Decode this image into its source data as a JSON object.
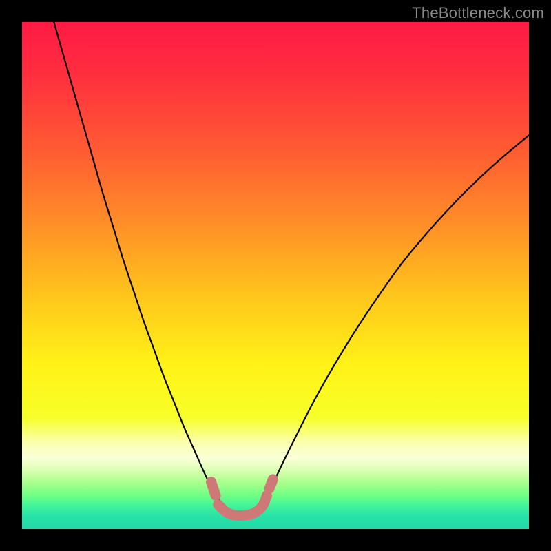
{
  "watermark": "TheBottleneck.com",
  "colors": {
    "curve": "#000000",
    "marker": "#cf7878",
    "background": "#000000",
    "gradient_stops": [
      {
        "offset": 0.0,
        "color": "#ff1a44"
      },
      {
        "offset": 0.1,
        "color": "#ff2e3f"
      },
      {
        "offset": 0.25,
        "color": "#ff5a33"
      },
      {
        "offset": 0.4,
        "color": "#ff8f27"
      },
      {
        "offset": 0.55,
        "color": "#ffc91c"
      },
      {
        "offset": 0.68,
        "color": "#fff317"
      },
      {
        "offset": 0.78,
        "color": "#f7ff28"
      },
      {
        "offset": 0.83,
        "color": "#faffb0"
      },
      {
        "offset": 0.86,
        "color": "#fbffd8"
      },
      {
        "offset": 0.885,
        "color": "#d8ffb0"
      },
      {
        "offset": 0.91,
        "color": "#a6ff8a"
      },
      {
        "offset": 0.935,
        "color": "#6dff85"
      },
      {
        "offset": 0.955,
        "color": "#40f29a"
      },
      {
        "offset": 0.975,
        "color": "#28e2a8"
      },
      {
        "offset": 1.0,
        "color": "#22d8a6"
      }
    ]
  },
  "chart_data": {
    "type": "line",
    "title": "",
    "xlabel": "",
    "ylabel": "",
    "xlim": [
      0,
      100
    ],
    "ylim": [
      0,
      100
    ],
    "series": [
      {
        "name": "curve-left",
        "x": [
          6,
          8,
          10,
          12,
          14,
          16,
          18,
          20,
          22,
          24,
          26,
          28,
          30,
          32,
          34,
          36,
          37,
          38,
          39,
          40,
          41,
          42
        ],
        "y": [
          101,
          94,
          87,
          80,
          73,
          66,
          59.5,
          53,
          47,
          41,
          35.5,
          30,
          25,
          20,
          15.5,
          11,
          9,
          7.2,
          5.6,
          4.2,
          3.2,
          2.6
        ]
      },
      {
        "name": "curve-right",
        "x": [
          42,
          43,
          44,
          45,
          46,
          47,
          48,
          49,
          50,
          52,
          55,
          58,
          62,
          66,
          70,
          75,
          80,
          85,
          90,
          95,
          101
        ],
        "y": [
          2.6,
          2.6,
          2.8,
          3.2,
          3.8,
          4.8,
          6.2,
          8.0,
          10.0,
          14.2,
          20.2,
          26,
          33,
          39.5,
          45.5,
          52.5,
          58.5,
          64,
          69,
          73.5,
          78.5
        ]
      }
    ],
    "markers": {
      "name": "bottom-j-marker",
      "segments": [
        {
          "x": [
            37.3,
            38.2
          ],
          "y": [
            9.3,
            6.6
          ]
        },
        {
          "x": [
            38.7,
            40.2,
            42.0,
            44.0,
            45.7,
            47.4,
            48.3
          ],
          "y": [
            4.8,
            3.4,
            2.7,
            2.7,
            3.1,
            4.5,
            6.6
          ]
        },
        {
          "x": [
            48.8,
            49.5
          ],
          "y": [
            8.0,
            9.8
          ]
        }
      ]
    }
  }
}
